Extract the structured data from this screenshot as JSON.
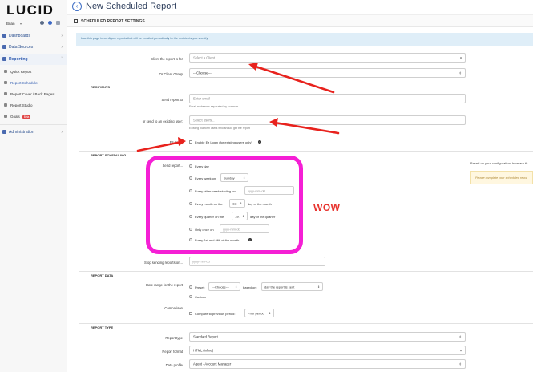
{
  "sidebar": {
    "logo": "LUCID",
    "user": "Brian",
    "items": [
      {
        "label": "Dashboards"
      },
      {
        "label": "Data Sources"
      },
      {
        "label": "Reporting"
      },
      {
        "label": "Administration"
      }
    ],
    "subitems": [
      {
        "label": "Quick Report"
      },
      {
        "label": "Report Scheduler"
      },
      {
        "label": "Report Cover / Back Pages"
      },
      {
        "label": "Report Studio"
      },
      {
        "label": "Goals",
        "badge": "Beta"
      }
    ]
  },
  "header": {
    "title": "New Scheduled Report",
    "section_title": "SCHEDULED REPORT SETTINGS"
  },
  "info": {
    "text": "Use this page to configure reports that will be emailed periodically to the recipients you specify."
  },
  "client": {
    "label": "Client the report is for",
    "placeholder": "Select a Client...",
    "group_label": "Or Client Group",
    "group_value": "---Choose---"
  },
  "recipients": {
    "heading": "RECIPIENTS",
    "send_to_label": "Send report to",
    "send_to_placeholder": "Enter email",
    "send_to_help": "Email addresses separated by commas",
    "existing_label": "or send to an existing user:",
    "existing_placeholder": "Select users...",
    "existing_help": "Existing platform users who should get the report",
    "ez_label": "Ez Login",
    "ez_option": "Enable Ez Login (for existing users only)"
  },
  "scheduling": {
    "heading": "REPORT SCHEDULING",
    "send_label": "Send report...",
    "every_day": "Every day",
    "every_week": "Every week on",
    "weekday": "Sunday",
    "every_other_week": "Every other week starting on",
    "date_placeholder": "yyyy-mm-dd",
    "every_month": "Every month on the",
    "month_day": "1st",
    "day_of_month": "day of the month",
    "every_quarter": "Every quarter on the",
    "quarter_day": "1st",
    "day_of_quarter": "day of the quarter",
    "only_once": "Only once on",
    "first_fifth": "Every 1st and fifth of the month",
    "stop_label": "Stop sending reports on...",
    "right_note": "Based on your configuration, here are th",
    "right_warning": "Please complete your scheduled repor"
  },
  "report_data": {
    "heading": "REPORT DATA",
    "date_range_label": "Date range for the report",
    "preset": "Preset:",
    "preset_value": "---Choose---",
    "based_on": "based on:",
    "based_on_value": "day the report is sent",
    "custom": "Custom",
    "comparison_label": "Comparison",
    "compare_option": "Compare to previous period:",
    "prior_period": "Prior period"
  },
  "report_type": {
    "heading": "REPORT TYPE",
    "type_label": "Report type",
    "type_value": "Standard Report",
    "format_label": "Report format",
    "format_value": "HTML (inline)",
    "profile_label": "Data profile",
    "profile_value": "Agent - Account Manager"
  },
  "annotation": {
    "wow": "WOW"
  }
}
